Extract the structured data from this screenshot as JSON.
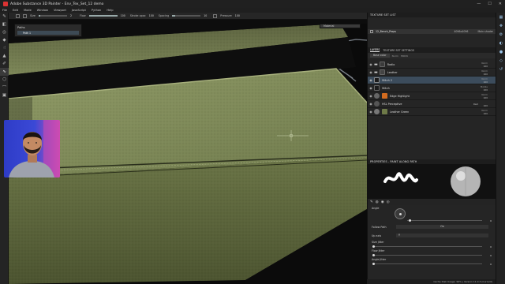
{
  "window": {
    "title": "Adobe Substance 3D Painter - Env_Tex_Set_12 demo",
    "controls": [
      "—",
      "☐",
      "✕"
    ]
  },
  "menu": [
    "File",
    "Edit",
    "Mode",
    "Window",
    "Viewport",
    "JavaScript",
    "Python",
    "Help"
  ],
  "tool_options": {
    "size_label": "Size",
    "size_value": "2",
    "size_fill": 0.05,
    "flow_label": "Flow",
    "flow_value": "100",
    "flow_fill": 1.0,
    "stroke_opacity_label": "Stroke opac",
    "stroke_opacity_value": "100",
    "spacing_label": "Spacing",
    "spacing_value": "10",
    "spacing_fill": 0.1,
    "pressure_label": "Pressure",
    "pressure_value": "100"
  },
  "left_tools": [
    "paint-brush-icon",
    "eraser-icon",
    "projection-icon",
    "polygon-fill-icon",
    "smudge-icon",
    "clone-icon",
    "color-picker-icon",
    "geometry-mask-icon",
    "path-icon",
    "measure-icon"
  ],
  "path_panel": {
    "title": "Paths",
    "row": "Path 1"
  },
  "material_chip": "Material",
  "texture_set_list": {
    "header": "TEXTURE SET LIST",
    "row_name": "12_Bench_Props",
    "row_res": "4096x4096",
    "row_shader": "Main shader"
  },
  "layers_panel": {
    "tab_layers": "LAYERS",
    "tab_settings": "TEXTURE SET SETTINGS",
    "channel": "Base color",
    "col_label": "Norm",
    "col_label2": "HRDN",
    "layers": [
      {
        "name": "Radio",
        "blend": "Norm",
        "opacity": "100",
        "type": "fill",
        "thumb": "#3b3b3b",
        "selected": false
      },
      {
        "name": "Leather",
        "blend": "Norm",
        "opacity": "100",
        "type": "folder",
        "thumb": "#444",
        "selected": false
      },
      {
        "name": "Stitch 2",
        "blend": "Norm",
        "opacity": "100",
        "type": "paint",
        "thumb": "#1c1c1c",
        "selected": true
      },
      {
        "name": "Stitch",
        "blend": "Mobile",
        "opacity": "100",
        "type": "paint",
        "thumb": "#1c1c1c",
        "selected": false
      },
      {
        "name": "Edge Highlight",
        "blend": "Norm",
        "opacity": "100",
        "type": "fill",
        "thumb": "#d26b1f",
        "selected": false
      },
      {
        "name": "HSL Perceptive",
        "blend": "Pass",
        "opacity": "100",
        "type": "filter",
        "thumb": "#555",
        "selected": false
      },
      {
        "name": "Leather Green",
        "blend": "Norm",
        "opacity": "100",
        "type": "fill",
        "thumb": "#6e7a48",
        "selected": false
      }
    ],
    "hsl_channel": "Rwd"
  },
  "properties": {
    "header": "PROPERTIES - PAINT ALONG PATH",
    "angle_label": "Angle",
    "angle_fill": 0.02,
    "angle_value": "0",
    "follow_path_label": "Follow Path",
    "follow_path_value": "On",
    "up_axis_label": "Up axis",
    "up_axis_value": "Y",
    "size_jitter_label": "Size Jitter",
    "size_jitter_value": "0",
    "flow_jitter_label": "Flow Jitter",
    "flow_jitter_value": "0",
    "angle_jitter_label": "Angle Jitter",
    "angle_jitter_value": "0"
  },
  "status_bar": "Cache Disk Usage: 99% | Version 11.0.3 (Current)",
  "colors": {
    "accent": "#3c4c5c",
    "leather": "#6e7a48",
    "link_blue": "#9cc4e8"
  }
}
